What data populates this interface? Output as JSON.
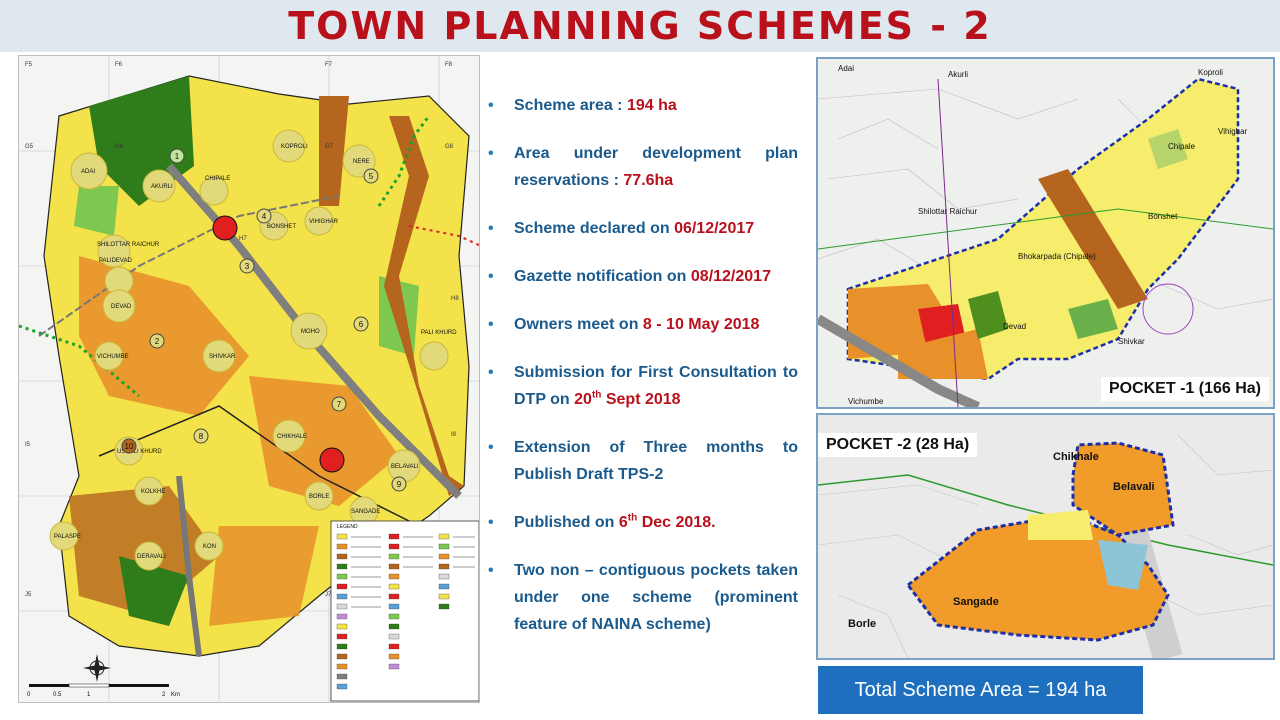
{
  "title": "TOWN PLANNING SCHEMES - 2",
  "bullets": [
    {
      "text": "Scheme area : ",
      "value": "194 ha"
    },
    {
      "text": "Area under development plan reservations : ",
      "value": "77.6ha"
    },
    {
      "text": "Scheme declared on ",
      "value": "06/12/2017"
    },
    {
      "text": "Gazette notification on ",
      "value": "08/12/2017"
    },
    {
      "text": "Owners meet on ",
      "value": "8  - 10 May 2018"
    },
    {
      "text": "Submission for First Consultation to DTP on ",
      "value_pre": "20",
      "value_sup": "th",
      "value_post": " Sept 2018"
    },
    {
      "text": "Extension of Three months to Publish Draft TPS-2"
    },
    {
      "text": "Published on ",
      "value_pre": "6",
      "value_sup": "th",
      "value_post": " Dec 2018."
    },
    {
      "text": "Two non – contiguous pockets taken under one scheme (prominent feature of NAINA scheme)"
    }
  ],
  "main_map": {
    "villages": [
      "ADAI",
      "AKURLI",
      "KOPROLI",
      "NERE",
      "CHIPALE",
      "BONSHET",
      "VIHIGHAR",
      "SHILOTTAR RAICHUR",
      "PALIDEVAD",
      "DEVAD",
      "MOHO",
      "VICHUMBE",
      "SHIVKAR",
      "CHIKHALE",
      "PALI KHURD",
      "USARLI KHURD",
      "KOLKHE",
      "BORLE",
      "SANGADE",
      "BELAVALI",
      "PALASPE",
      "DERAVALI",
      "KON"
    ],
    "zones": [
      "1",
      "2",
      "3",
      "4",
      "5",
      "6",
      "7",
      "8",
      "9",
      "10"
    ],
    "grid_refs": [
      "F5",
      "F6",
      "F7",
      "F8",
      "G5",
      "G6",
      "G7",
      "G8",
      "H7",
      "H8",
      "I5",
      "I8",
      "J5",
      "J7"
    ],
    "scale": [
      "0",
      "0.5",
      "1",
      "2",
      "Km"
    ],
    "legend_title": "LEGEND"
  },
  "pocket1": {
    "label": "POCKET -1 (166 Ha)",
    "places": [
      "Adai",
      "Akurli",
      "Koproli",
      "Chipale",
      "Vihighar",
      "Shilottar Raichur",
      "Bonshet",
      "Bhokarpada (Chipale)",
      "Devad",
      "Shivkar",
      "Vichumbe"
    ]
  },
  "pocket2": {
    "label": "POCKET -2 (28 Ha)",
    "places": [
      "Chikhale",
      "Belavali",
      "Sangade",
      "Borle"
    ]
  },
  "total": "Total Scheme Area = 194 ha",
  "colors": {
    "title": "#b8111c",
    "text": "#1a5a8c",
    "accent": "#1f6fbf",
    "residential": "#f3e24a",
    "growth": "#e8912a",
    "green": "#2e7d1a"
  }
}
